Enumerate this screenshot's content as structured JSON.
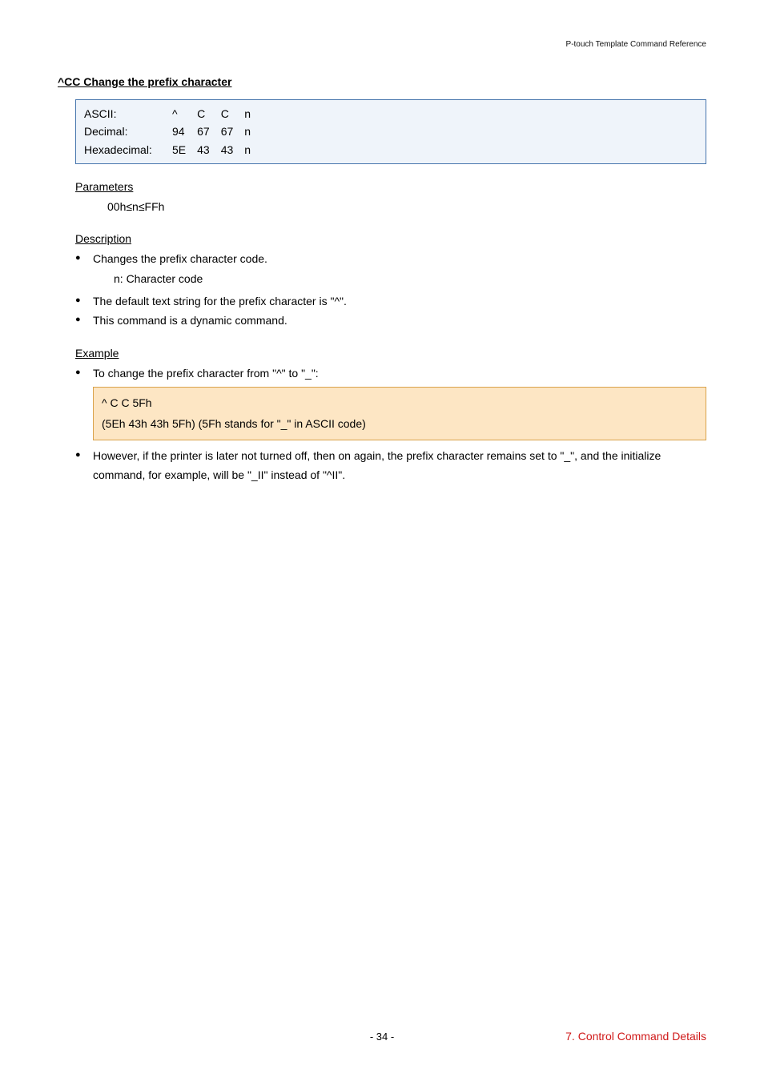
{
  "header": {
    "right": "P-touch Template Command Reference"
  },
  "title": "^CC            Change the prefix character",
  "code_table": {
    "rows": [
      {
        "label": "ASCII:",
        "c1": "^",
        "c2": "C",
        "c3": "C",
        "c4": "n"
      },
      {
        "label": "Decimal:",
        "c1": "94",
        "c2": "67",
        "c3": "67",
        "c4": "n"
      },
      {
        "label": "Hexadecimal:",
        "c1": "5E",
        "c2": "43",
        "c3": "43",
        "c4": "n"
      }
    ]
  },
  "parameters": {
    "heading": "Parameters",
    "line": "00h≤n≤FFh"
  },
  "description": {
    "heading": "Description",
    "bullets": [
      {
        "text": "Changes the prefix character code.",
        "sub": "n:  Character code"
      },
      {
        "text": "The default text string for the prefix character is \"^\"."
      },
      {
        "text": "This command is a dynamic command."
      }
    ]
  },
  "example": {
    "heading": "Example",
    "lead": "To change the prefix character from \"^\" to \"_\":",
    "box": {
      "line1": "^ C C 5Fh",
      "line2": "(5Eh 43h 43h 5Fh) (5Fh stands for \"_\" in ASCII code)"
    },
    "after": "However, if the printer is later not turned off, then on again, the prefix character remains set to \"_\", and the initialize command, for example, will be \"_II\" instead of \"^II\"."
  },
  "footer": {
    "page": "- 34 -",
    "right": "7. Control Command Details"
  }
}
